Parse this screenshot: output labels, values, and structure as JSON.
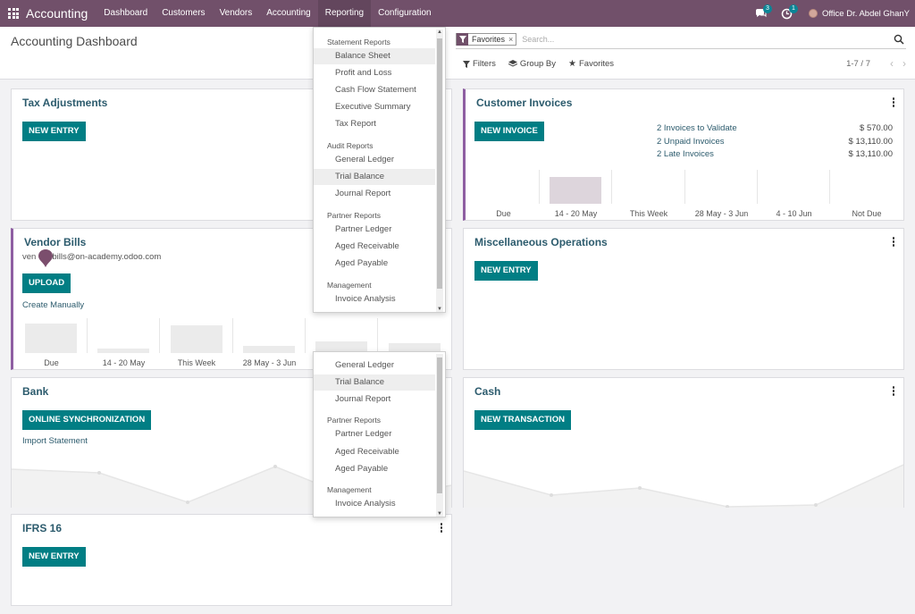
{
  "navbar": {
    "app_title": "Accounting",
    "menu": [
      "Dashboard",
      "Customers",
      "Vendors",
      "Accounting",
      "Reporting",
      "Configuration"
    ],
    "messages_count": "3",
    "activities_count": "1",
    "company": "Office Dr. Abdel GhanY"
  },
  "control": {
    "page_title": "Accounting Dashboard",
    "facet_label": "Favorites",
    "facet_remove": "×",
    "search_placeholder": "Search...",
    "filters_label": "Filters",
    "groupby_label": "Group By",
    "favorites_label": "Favorites",
    "pager": "1-7 / 7"
  },
  "cards": {
    "tax": {
      "title": "Tax Adjustments",
      "button": "NEW ENTRY"
    },
    "customer_invoices": {
      "title": "Customer Invoices",
      "button": "NEW INVOICE",
      "rows": [
        {
          "label": "2 Invoices to Validate",
          "amount": "$ 570.00"
        },
        {
          "label": "2 Unpaid Invoices",
          "amount": "$ 13,110.00"
        },
        {
          "label": "2 Late Invoices",
          "amount": "$ 13,110.00"
        }
      ],
      "chart_labels": [
        "Due",
        "14 - 20 May",
        "This Week",
        "28 May - 3 Jun",
        "4 - 10 Jun",
        "Not Due"
      ]
    },
    "vendor_bills": {
      "title": "Vendor Bills",
      "email_prefix": "ven",
      "email_suffix": "bills@on-academy.odoo.com",
      "button": "UPLOAD",
      "link": "Create Manually",
      "chart_labels": [
        "Due",
        "14 - 20 May",
        "This Week",
        "28 May - 3 Jun",
        "",
        ""
      ]
    },
    "misc": {
      "title": "Miscellaneous Operations",
      "button": "NEW ENTRY"
    },
    "bank": {
      "title": "Bank",
      "button": "ONLINE SYNCHRONIZATION",
      "link": "Import Statement"
    },
    "cash": {
      "title": "Cash",
      "button": "NEW TRANSACTION"
    },
    "ifrs": {
      "title": "IFRS 16",
      "button": "NEW ENTRY"
    }
  },
  "reporting_menu": {
    "statement_header": "Statement Reports",
    "statement_items": [
      "Balance Sheet",
      "Profit and Loss",
      "Cash Flow Statement",
      "Executive Summary",
      "Tax Report"
    ],
    "audit_header": "Audit Reports",
    "audit_items": [
      "General Ledger",
      "Trial Balance",
      "Journal Report"
    ],
    "partner_header": "Partner Reports",
    "partner_items": [
      "Partner Ledger",
      "Aged Receivable",
      "Aged Payable"
    ],
    "management_header": "Management",
    "management_items": [
      "Invoice Analysis"
    ]
  },
  "colors": {
    "navbar": "#71506a",
    "primary_button": "#017e84",
    "card_title": "#2c5b6d",
    "accent_border": "#8e5ea2"
  }
}
